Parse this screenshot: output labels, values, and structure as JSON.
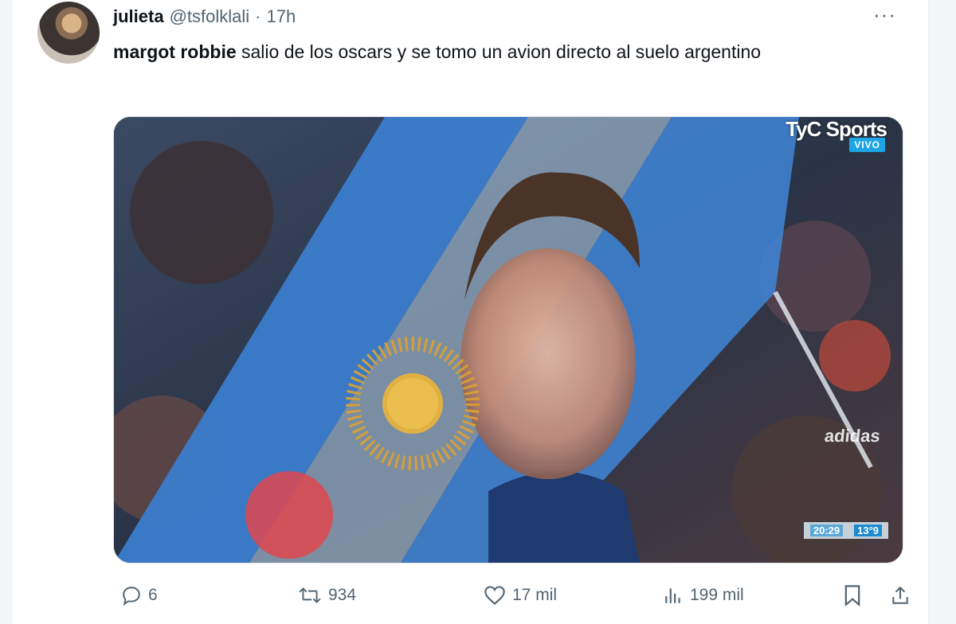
{
  "tweet": {
    "display_name": "julieta",
    "handle": "@tsfolklali",
    "separator": "·",
    "time": "17h",
    "more_icon": "···",
    "text_bold": "margot robbie",
    "text_rest": " salio de los oscars y se tomo un avion directo al suelo argentino"
  },
  "media": {
    "broadcaster": "TyC Sports",
    "live_badge": "VIVO",
    "watermark": "adidas",
    "clock_time": "20:29",
    "clock_temp": "13°9"
  },
  "actions": {
    "replies": "6",
    "retweets": "934",
    "likes": "17 mil",
    "views": "199 mil"
  },
  "colors": {
    "text": "#0f1419",
    "muted": "#536471",
    "flag_blue": "#5b9bd8",
    "live_blue": "#1da6e6"
  }
}
